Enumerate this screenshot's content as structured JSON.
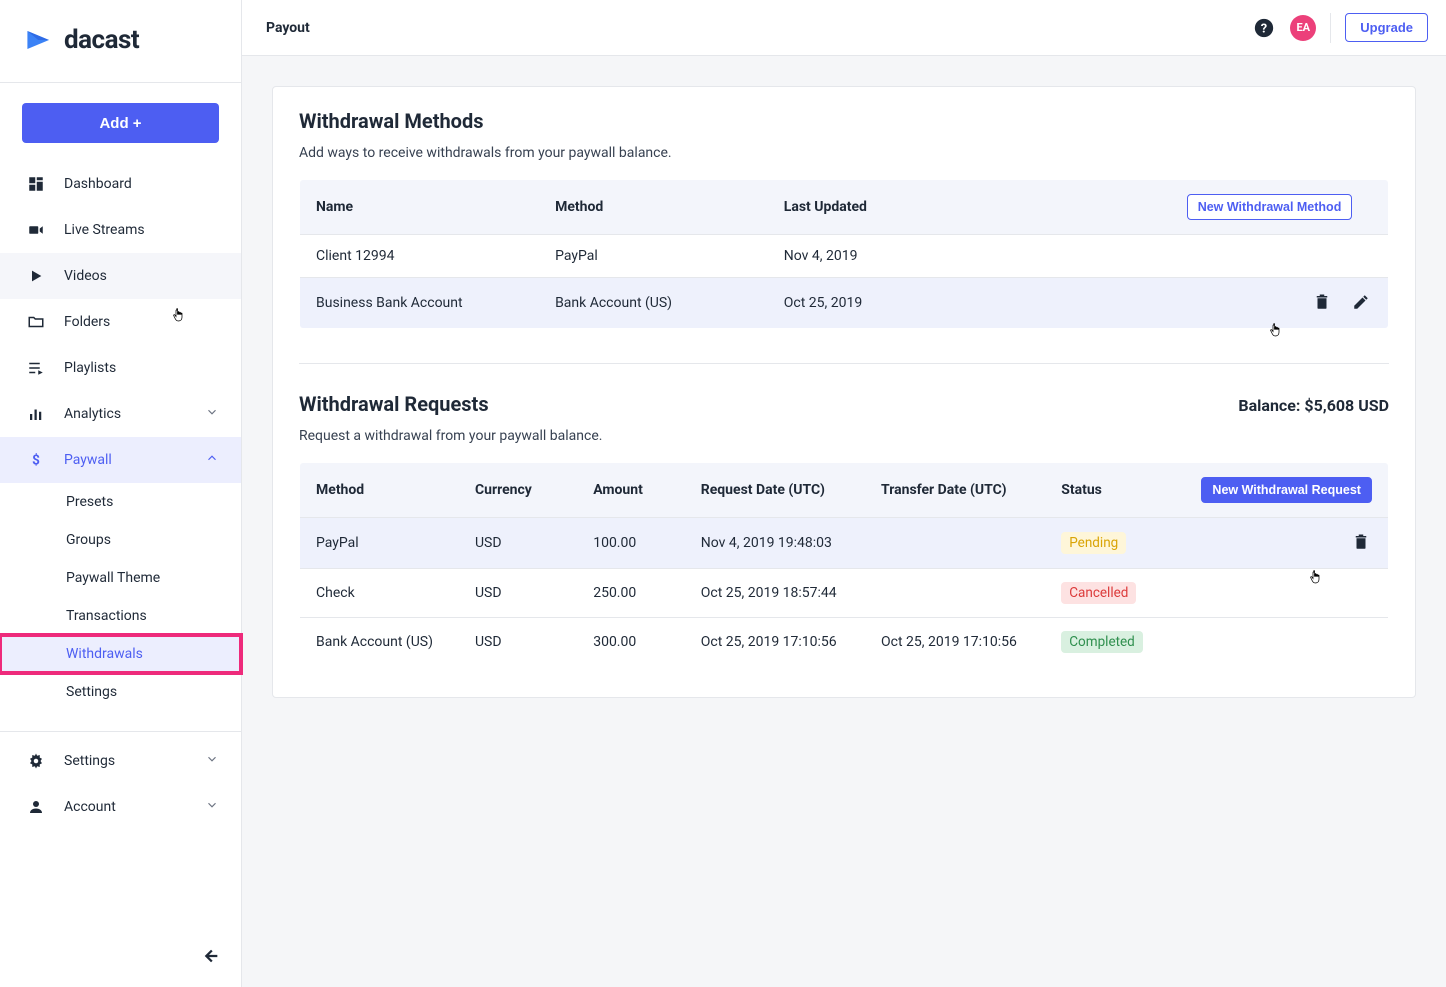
{
  "brand": "dacast",
  "add_button": "Add +",
  "page_title": "Payout",
  "upgrade": "Upgrade",
  "avatar_initials": "EA",
  "nav": {
    "dashboard": "Dashboard",
    "live_streams": "Live Streams",
    "videos": "Videos",
    "folders": "Folders",
    "playlists": "Playlists",
    "analytics": "Analytics",
    "paywall": "Paywall",
    "settings_main": "Settings",
    "account": "Account"
  },
  "paywall_sub": {
    "presets": "Presets",
    "groups": "Groups",
    "theme": "Paywall Theme",
    "transactions": "Transactions",
    "withdrawals": "Withdrawals",
    "settings": "Settings"
  },
  "methods": {
    "title": "Withdrawal Methods",
    "sub": "Add ways to receive withdrawals from your paywall balance.",
    "new_btn": "New Withdrawal Method",
    "cols": {
      "name": "Name",
      "method": "Method",
      "updated": "Last Updated"
    },
    "rows": [
      {
        "name": "Client 12994",
        "method": "PayPal",
        "updated": "Nov 4, 2019"
      },
      {
        "name": "Business Bank Account",
        "method": "Bank Account (US)",
        "updated": "Oct 25, 2019"
      }
    ]
  },
  "requests": {
    "title": "Withdrawal Requests",
    "sub": "Request a withdrawal from your paywall balance.",
    "balance": "Balance: $5,608 USD",
    "new_btn": "New Withdrawal Request",
    "cols": {
      "method": "Method",
      "currency": "Currency",
      "amount": "Amount",
      "req": "Request Date (UTC)",
      "trans": "Transfer Date (UTC)",
      "status": "Status"
    },
    "rows": [
      {
        "method": "PayPal",
        "currency": "USD",
        "amount": "100.00",
        "req": "Nov 4, 2019 19:48:03",
        "trans": "",
        "status": "Pending"
      },
      {
        "method": "Check",
        "currency": "USD",
        "amount": "250.00",
        "req": "Oct 25, 2019 18:57:44",
        "trans": "",
        "status": "Cancelled"
      },
      {
        "method": "Bank Account (US)",
        "currency": "USD",
        "amount": "300.00",
        "req": "Oct 25, 2019 17:10:56",
        "trans": "Oct 25, 2019 17:10:56",
        "status": "Completed"
      }
    ]
  }
}
